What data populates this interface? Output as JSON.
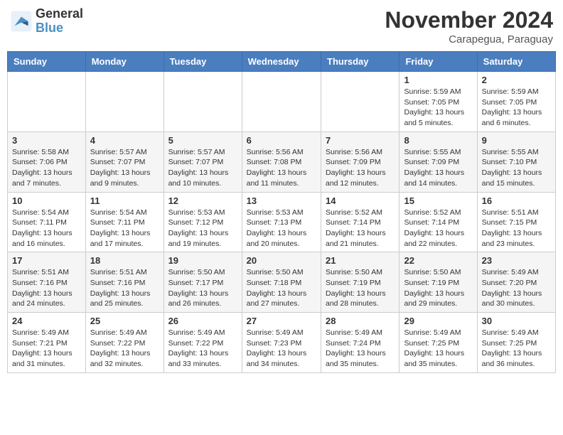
{
  "header": {
    "logo_general": "General",
    "logo_blue": "Blue",
    "month_title": "November 2024",
    "location": "Carapegua, Paraguay"
  },
  "weekdays": [
    "Sunday",
    "Monday",
    "Tuesday",
    "Wednesday",
    "Thursday",
    "Friday",
    "Saturday"
  ],
  "weeks": [
    [
      {
        "day": "",
        "info": ""
      },
      {
        "day": "",
        "info": ""
      },
      {
        "day": "",
        "info": ""
      },
      {
        "day": "",
        "info": ""
      },
      {
        "day": "",
        "info": ""
      },
      {
        "day": "1",
        "info": "Sunrise: 5:59 AM\nSunset: 7:05 PM\nDaylight: 13 hours\nand 5 minutes."
      },
      {
        "day": "2",
        "info": "Sunrise: 5:59 AM\nSunset: 7:05 PM\nDaylight: 13 hours\nand 6 minutes."
      }
    ],
    [
      {
        "day": "3",
        "info": "Sunrise: 5:58 AM\nSunset: 7:06 PM\nDaylight: 13 hours\nand 7 minutes."
      },
      {
        "day": "4",
        "info": "Sunrise: 5:57 AM\nSunset: 7:07 PM\nDaylight: 13 hours\nand 9 minutes."
      },
      {
        "day": "5",
        "info": "Sunrise: 5:57 AM\nSunset: 7:07 PM\nDaylight: 13 hours\nand 10 minutes."
      },
      {
        "day": "6",
        "info": "Sunrise: 5:56 AM\nSunset: 7:08 PM\nDaylight: 13 hours\nand 11 minutes."
      },
      {
        "day": "7",
        "info": "Sunrise: 5:56 AM\nSunset: 7:09 PM\nDaylight: 13 hours\nand 12 minutes."
      },
      {
        "day": "8",
        "info": "Sunrise: 5:55 AM\nSunset: 7:09 PM\nDaylight: 13 hours\nand 14 minutes."
      },
      {
        "day": "9",
        "info": "Sunrise: 5:55 AM\nSunset: 7:10 PM\nDaylight: 13 hours\nand 15 minutes."
      }
    ],
    [
      {
        "day": "10",
        "info": "Sunrise: 5:54 AM\nSunset: 7:11 PM\nDaylight: 13 hours\nand 16 minutes."
      },
      {
        "day": "11",
        "info": "Sunrise: 5:54 AM\nSunset: 7:11 PM\nDaylight: 13 hours\nand 17 minutes."
      },
      {
        "day": "12",
        "info": "Sunrise: 5:53 AM\nSunset: 7:12 PM\nDaylight: 13 hours\nand 19 minutes."
      },
      {
        "day": "13",
        "info": "Sunrise: 5:53 AM\nSunset: 7:13 PM\nDaylight: 13 hours\nand 20 minutes."
      },
      {
        "day": "14",
        "info": "Sunrise: 5:52 AM\nSunset: 7:14 PM\nDaylight: 13 hours\nand 21 minutes."
      },
      {
        "day": "15",
        "info": "Sunrise: 5:52 AM\nSunset: 7:14 PM\nDaylight: 13 hours\nand 22 minutes."
      },
      {
        "day": "16",
        "info": "Sunrise: 5:51 AM\nSunset: 7:15 PM\nDaylight: 13 hours\nand 23 minutes."
      }
    ],
    [
      {
        "day": "17",
        "info": "Sunrise: 5:51 AM\nSunset: 7:16 PM\nDaylight: 13 hours\nand 24 minutes."
      },
      {
        "day": "18",
        "info": "Sunrise: 5:51 AM\nSunset: 7:16 PM\nDaylight: 13 hours\nand 25 minutes."
      },
      {
        "day": "19",
        "info": "Sunrise: 5:50 AM\nSunset: 7:17 PM\nDaylight: 13 hours\nand 26 minutes."
      },
      {
        "day": "20",
        "info": "Sunrise: 5:50 AM\nSunset: 7:18 PM\nDaylight: 13 hours\nand 27 minutes."
      },
      {
        "day": "21",
        "info": "Sunrise: 5:50 AM\nSunset: 7:19 PM\nDaylight: 13 hours\nand 28 minutes."
      },
      {
        "day": "22",
        "info": "Sunrise: 5:50 AM\nSunset: 7:19 PM\nDaylight: 13 hours\nand 29 minutes."
      },
      {
        "day": "23",
        "info": "Sunrise: 5:49 AM\nSunset: 7:20 PM\nDaylight: 13 hours\nand 30 minutes."
      }
    ],
    [
      {
        "day": "24",
        "info": "Sunrise: 5:49 AM\nSunset: 7:21 PM\nDaylight: 13 hours\nand 31 minutes."
      },
      {
        "day": "25",
        "info": "Sunrise: 5:49 AM\nSunset: 7:22 PM\nDaylight: 13 hours\nand 32 minutes."
      },
      {
        "day": "26",
        "info": "Sunrise: 5:49 AM\nSunset: 7:22 PM\nDaylight: 13 hours\nand 33 minutes."
      },
      {
        "day": "27",
        "info": "Sunrise: 5:49 AM\nSunset: 7:23 PM\nDaylight: 13 hours\nand 34 minutes."
      },
      {
        "day": "28",
        "info": "Sunrise: 5:49 AM\nSunset: 7:24 PM\nDaylight: 13 hours\nand 35 minutes."
      },
      {
        "day": "29",
        "info": "Sunrise: 5:49 AM\nSunset: 7:25 PM\nDaylight: 13 hours\nand 35 minutes."
      },
      {
        "day": "30",
        "info": "Sunrise: 5:49 AM\nSunset: 7:25 PM\nDaylight: 13 hours\nand 36 minutes."
      }
    ]
  ]
}
